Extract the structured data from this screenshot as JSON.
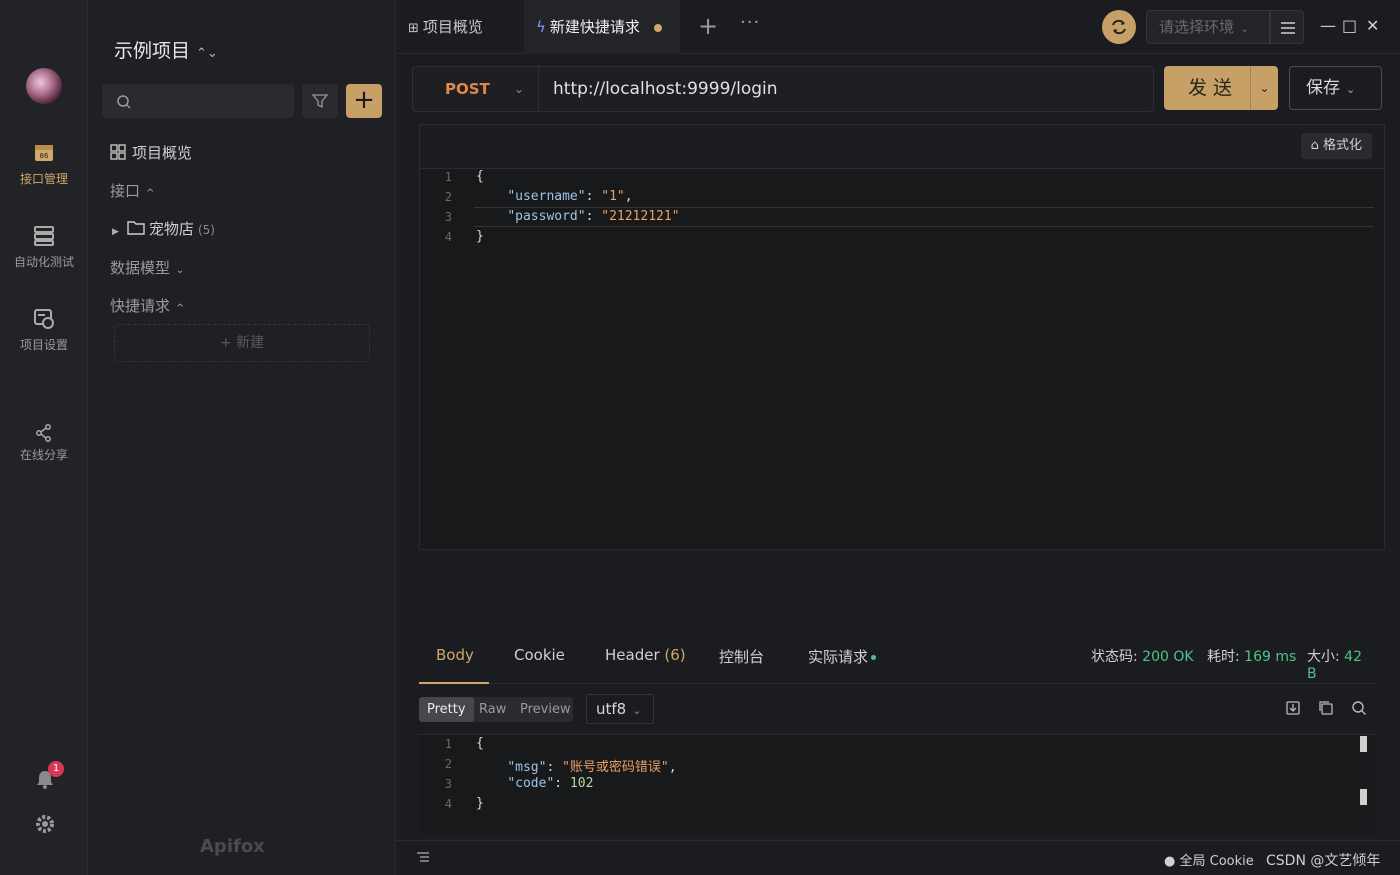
{
  "rail": {
    "items": [
      {
        "label": "接口管理",
        "icon": "api-folder-icon",
        "active": true
      },
      {
        "label": "自动化测试",
        "icon": "server-stack-icon",
        "active": false
      },
      {
        "label": "项目设置",
        "icon": "settings-monitor-icon",
        "active": false
      },
      {
        "label": "在线分享",
        "icon": "share-icon",
        "active": false
      }
    ],
    "notification_count": "1"
  },
  "sidebar": {
    "project_title": "示例项目",
    "sort_icon": "⌃⌄",
    "overview": "项目概览",
    "api_section": "接口",
    "folder": {
      "name": "宠物店",
      "count": "(5)"
    },
    "data_model": "数据模型",
    "quick_request": "快捷请求",
    "new_label": "+ 新建",
    "brand": "Apifox"
  },
  "tabs": {
    "overview": "项目概览",
    "quick": "新建快捷请求",
    "plus": "+",
    "more": "···",
    "env_placeholder": "请选择环境"
  },
  "request": {
    "method": "POST",
    "url": "http://localhost:9999/login",
    "send": "发送",
    "save": "保存",
    "format": "格式化"
  },
  "body_code": [
    {
      "n": "1",
      "parts": [
        {
          "t": "{",
          "c": "p"
        }
      ]
    },
    {
      "n": "2",
      "parts": [
        {
          "t": "    ",
          "c": "p"
        },
        {
          "t": "\"username\"",
          "c": "k"
        },
        {
          "t": ": ",
          "c": "p"
        },
        {
          "t": "\"1\"",
          "c": "s"
        },
        {
          "t": ",",
          "c": "p"
        }
      ]
    },
    {
      "n": "3",
      "parts": [
        {
          "t": "    ",
          "c": "p"
        },
        {
          "t": "\"password\"",
          "c": "k"
        },
        {
          "t": ": ",
          "c": "p"
        },
        {
          "t": "\"21212121\"",
          "c": "s"
        }
      ]
    },
    {
      "n": "4",
      "parts": [
        {
          "t": "}",
          "c": "p"
        }
      ]
    }
  ],
  "response": {
    "tabs": {
      "body": "Body",
      "cookie": "Cookie",
      "header": "Header",
      "header_count": "(6)",
      "console": "控制台",
      "actual": "实际请求"
    },
    "status_label": "状态码:",
    "status_value": "200 OK",
    "time_label": "耗时:",
    "time_value": "169 ms",
    "size_label": "大小:",
    "size_value": "42 B",
    "views": {
      "pretty": "Pretty",
      "raw": "Raw",
      "preview": "Preview"
    },
    "encoding": "utf8"
  },
  "resp_code": [
    {
      "n": "1",
      "parts": [
        {
          "t": "{",
          "c": "p"
        }
      ]
    },
    {
      "n": "2",
      "parts": [
        {
          "t": "    ",
          "c": "p"
        },
        {
          "t": "\"msg\"",
          "c": "k"
        },
        {
          "t": ": ",
          "c": "p"
        },
        {
          "t": "\"账号或密码错误\"",
          "c": "s"
        },
        {
          "t": ",",
          "c": "p"
        }
      ]
    },
    {
      "n": "3",
      "parts": [
        {
          "t": "    ",
          "c": "p"
        },
        {
          "t": "\"code\"",
          "c": "k"
        },
        {
          "t": ": ",
          "c": "p"
        },
        {
          "t": "102",
          "c": "n"
        }
      ]
    },
    {
      "n": "4",
      "parts": [
        {
          "t": "}",
          "c": "p"
        }
      ]
    }
  ],
  "footer": {
    "cookie": "全局 Cookie",
    "watermark": "CSDN @文艺倾年"
  },
  "colors": {
    "accent": "#c6a066",
    "method": "#e0884a",
    "success": "#4cc38a"
  }
}
